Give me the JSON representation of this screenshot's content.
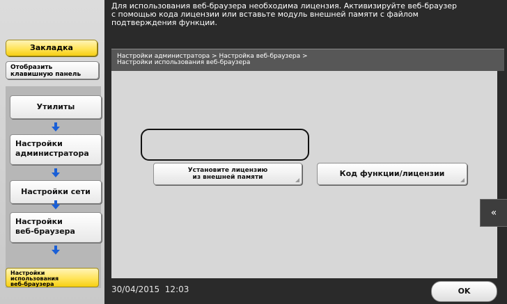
{
  "sidebar": {
    "bookmark_label": "Закладка",
    "keyboard_label_line1": "Отобразить",
    "keyboard_label_line2": "клавишную панель",
    "nav": {
      "utilities": "Утилиты",
      "admin_line1": "Настройки",
      "admin_line2": "администратора",
      "network": "Настройки сети",
      "browser_line1": "Настройки",
      "browser_line2": "веб-браузера",
      "current_line1": "Настройки",
      "current_line2": "использования",
      "current_line3": "веб-браузера"
    }
  },
  "message": {
    "line1": "Для использования веб-браузера необходима лицензия. Активизируйте веб-браузер",
    "line2": "с помощью кода лицензии или вставьте модуль внешней памяти с файлом",
    "line3": "подтверждения функции."
  },
  "breadcrumb": {
    "line1": "Настройки администратора > Настройка веб-браузера >",
    "line2": "Настройки использования веб-браузера"
  },
  "buttons": {
    "install_license_line1": "Установите лицензию",
    "install_license_line2": "из внешней памяти",
    "function_code": "Код функции/лицензии",
    "collapse_icon": "«",
    "ok": "OK"
  },
  "status": {
    "datetime": "30/04/2015  12:03"
  },
  "colors": {
    "accent_yellow": "#ffe45a",
    "arrow_blue": "#1a5fd6",
    "dark_bg": "#2a2a2a"
  }
}
